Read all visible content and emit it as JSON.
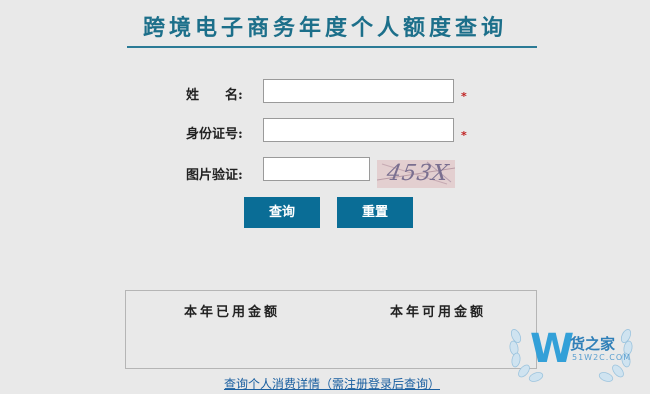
{
  "header": {
    "title": "跨境电子商务年度个人额度查询"
  },
  "form": {
    "name_label": "姓　　名:",
    "id_label": "身份证号:",
    "captcha_label": "图片验证:",
    "name_value": "",
    "id_value": "",
    "captcha_value": "",
    "required_mark": "*",
    "captcha_image_text": "453X"
  },
  "buttons": {
    "query": "查询",
    "reset": "重置"
  },
  "results": {
    "used_label": "本年已用金额",
    "available_label": "本年可用金额"
  },
  "link": {
    "details": "查询个人消费详情（需注册登录后查询）"
  },
  "watermark": {
    "letter": "W",
    "name": "货之家",
    "url": "51W2C.COM"
  },
  "colors": {
    "title": "#1c6f8a",
    "button": "#0a6d96",
    "required": "#c02020",
    "link": "#1a5fa0"
  }
}
